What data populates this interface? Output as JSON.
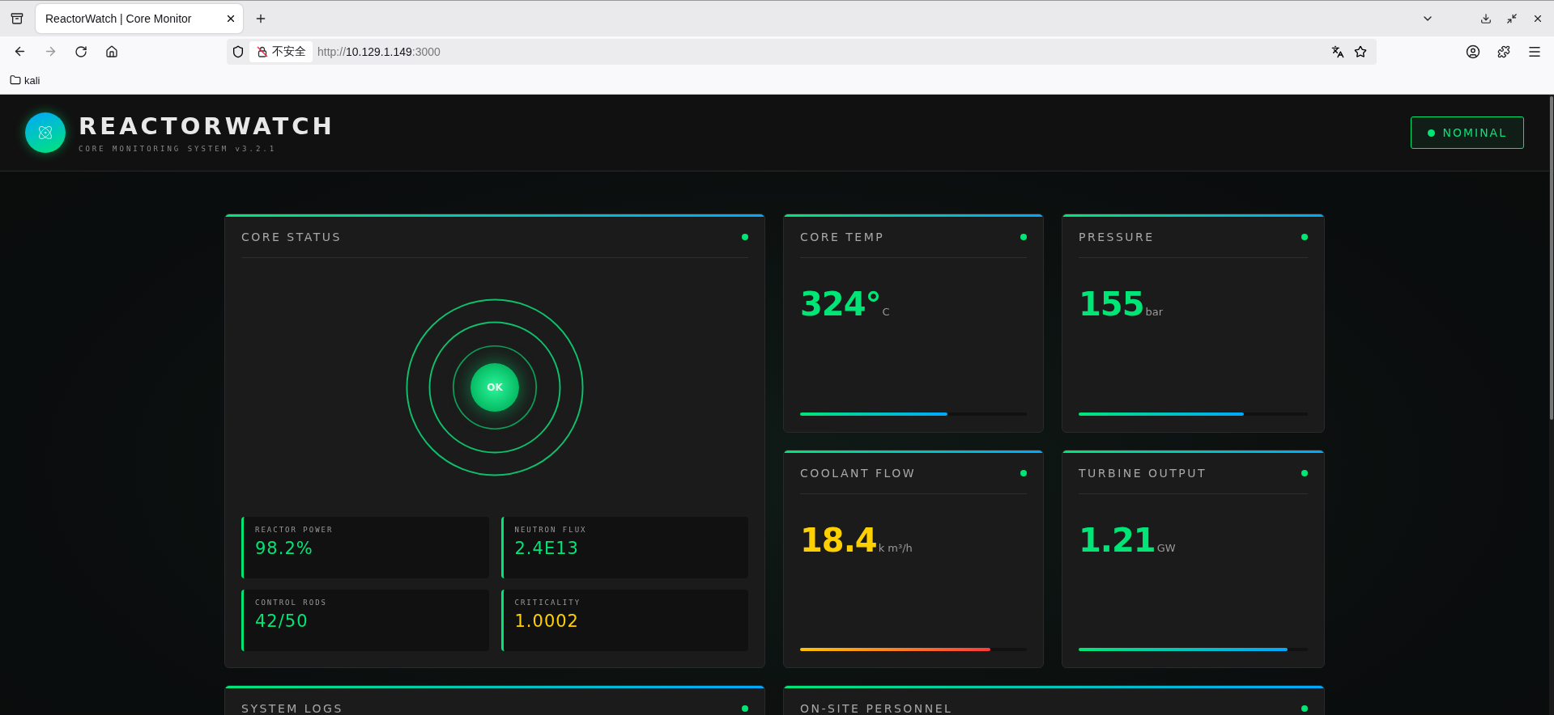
{
  "browser": {
    "tab_title": "ReactorWatch | Core Monitor",
    "security_badge": "不安全",
    "url": {
      "scheme": "http://",
      "host": "10.129.1.149",
      "port": ":3000"
    },
    "bookmarks": [
      "kali"
    ]
  },
  "header": {
    "title": "REACTORWATCH",
    "subtitle": "CORE MONITORING SYSTEM v3.2.1",
    "status": "NOMINAL"
  },
  "core_status": {
    "title": "CORE STATUS",
    "indicator": "OK",
    "stats": [
      {
        "label": "REACTOR POWER",
        "value": "98.2%",
        "warning": false
      },
      {
        "label": "NEUTRON FLUX",
        "value": "2.4E13",
        "warning": false
      },
      {
        "label": "CONTROL RODS",
        "value": "42/50",
        "warning": false
      },
      {
        "label": "CRITICALITY",
        "value": "1.0002",
        "warning": true
      }
    ]
  },
  "metrics": [
    {
      "title": "CORE TEMP",
      "value": "324°",
      "unit": "C",
      "warning": false,
      "level": 0.65
    },
    {
      "title": "PRESSURE",
      "value": "155",
      "unit": "bar",
      "warning": false,
      "level": 0.72
    },
    {
      "title": "COOLANT FLOW",
      "value": "18.4",
      "unit": "k m³/h",
      "warning": true,
      "level": 0.84
    },
    {
      "title": "TURBINE OUTPUT",
      "value": "1.21",
      "unit": "GW",
      "warning": false,
      "level": 0.91
    }
  ],
  "lower_panels": [
    {
      "title": "SYSTEM LOGS"
    },
    {
      "title": "ON-SITE PERSONNEL"
    }
  ]
}
